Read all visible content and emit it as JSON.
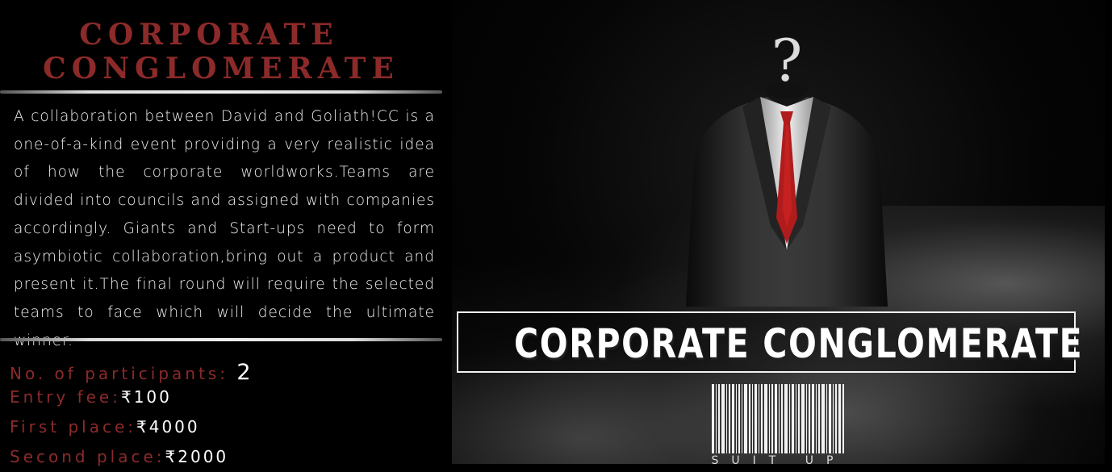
{
  "event": {
    "title_line1": "CORPORATE",
    "title_line2": "CONGLOMERATE",
    "description": "A collaboration between David and Goliath!CC is a one-of-a-kind event providing a very realistic idea of how the corporate worldworks.Teams are divided into councils and assigned with companies accordingly. Giants and Start-ups need to form asymbiotic collaboration,bring out a product and present it.The final round will require the selected teams to face which will decide the ultimate winner."
  },
  "info": {
    "participants_label": "No. of participants:",
    "participants_value": "2",
    "fee_label": "Entry fee:",
    "fee_value": "₹100",
    "first_label": "First place:",
    "first_value": "₹4000",
    "second_label": "Second place:",
    "second_value": "₹2000"
  },
  "poster": {
    "title": "CORPORATE CONGLOMERATE",
    "barcode_text": "SUIT UP",
    "question_mark": "?"
  },
  "colors": {
    "accent": "#8c2a2a",
    "text": "#f0f0f0",
    "background": "#000000",
    "tie": "#b01c1c"
  }
}
